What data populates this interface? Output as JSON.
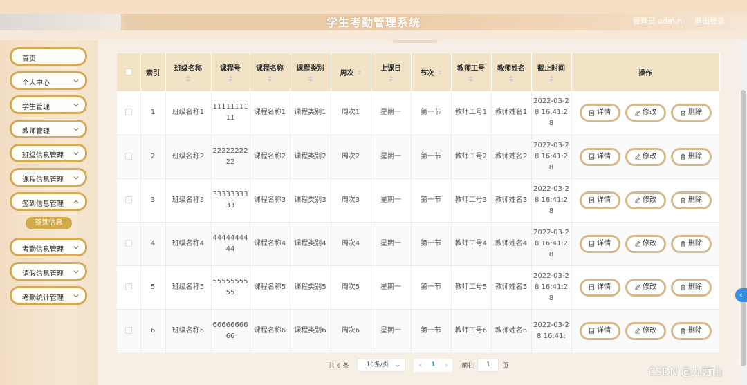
{
  "header": {
    "title": "学生考勤管理系统",
    "user": "管理员 admin",
    "logout": "退出登录"
  },
  "sidebar": {
    "items": [
      {
        "label": "首页",
        "has_children": false
      },
      {
        "label": "个人中心",
        "has_children": true
      },
      {
        "label": "学生管理",
        "has_children": true
      },
      {
        "label": "教师管理",
        "has_children": true
      },
      {
        "label": "班级信息管理",
        "has_children": true
      },
      {
        "label": "课程信息管理",
        "has_children": true
      },
      {
        "label": "签到信息管理",
        "has_children": true,
        "expanded": true
      },
      {
        "label": "考勤信息管理",
        "has_children": true
      },
      {
        "label": "请假信息管理",
        "has_children": true
      },
      {
        "label": "考勤统计管理",
        "has_children": true
      }
    ],
    "sub_item": "签到信息"
  },
  "table": {
    "columns": [
      "索引",
      "班级名称",
      "课程号",
      "课程名称",
      "课程类别",
      "周次",
      "上课日",
      "节次",
      "教师工号",
      "教师姓名",
      "截止时间",
      "操作"
    ],
    "rows": [
      {
        "index": "1",
        "class_name": "班级名称1",
        "course_no": "1111111111",
        "course_name": "课程名称1",
        "course_type": "课程类别1",
        "week": "周次1",
        "day": "星期一",
        "period": "第一节",
        "teacher_no": "教师工号1",
        "teacher_name": "教师姓名1",
        "deadline": "2022-03-28 16:41:28"
      },
      {
        "index": "2",
        "class_name": "班级名称2",
        "course_no": "2222222222",
        "course_name": "课程名称2",
        "course_type": "课程类别2",
        "week": "周次2",
        "day": "星期一",
        "period": "第一节",
        "teacher_no": "教师工号2",
        "teacher_name": "教师姓名2",
        "deadline": "2022-03-28 16:41:28"
      },
      {
        "index": "3",
        "class_name": "班级名称3",
        "course_no": "3333333333",
        "course_name": "课程名称3",
        "course_type": "课程类别3",
        "week": "周次3",
        "day": "星期一",
        "period": "第一节",
        "teacher_no": "教师工号3",
        "teacher_name": "教师姓名3",
        "deadline": "2022-03-28 16:41:28"
      },
      {
        "index": "4",
        "class_name": "班级名称4",
        "course_no": "4444444444",
        "course_name": "课程名称4",
        "course_type": "课程类别4",
        "week": "周次4",
        "day": "星期一",
        "period": "第一节",
        "teacher_no": "教师工号4",
        "teacher_name": "教师姓名4",
        "deadline": "2022-03-28 16:41:28"
      },
      {
        "index": "5",
        "class_name": "班级名称5",
        "course_no": "5555555555",
        "course_name": "课程名称5",
        "course_type": "课程类别5",
        "week": "周次5",
        "day": "星期一",
        "period": "第一节",
        "teacher_no": "教师工号5",
        "teacher_name": "教师姓名5",
        "deadline": "2022-03-28 16:41:28"
      },
      {
        "index": "6",
        "class_name": "班级名称6",
        "course_no": "6666666666",
        "course_name": "课程名称6",
        "course_type": "课程类别6",
        "week": "周次6",
        "day": "星期一",
        "period": "第一节",
        "teacher_no": "教师工号6",
        "teacher_name": "教师姓名6",
        "deadline": "2022-03-28 16:41:"
      }
    ],
    "actions": {
      "detail": "详情",
      "edit": "修改",
      "delete": "删除"
    }
  },
  "pager": {
    "total": "共 6 条",
    "page_size": "10条/页",
    "prev": "‹",
    "current": "1",
    "next": "›",
    "goto_label": "前往",
    "goto_value": "1",
    "page_suffix": "页"
  },
  "float_tab": "‹",
  "watermark": "CSDN @九嶷山",
  "colors": {
    "accent": "#d5aa56",
    "header_bg": "#f3e3c6",
    "sub_item": "#d2aa4a",
    "page_current": "#2a9bb3",
    "float_tab": "#3a8ee6"
  }
}
